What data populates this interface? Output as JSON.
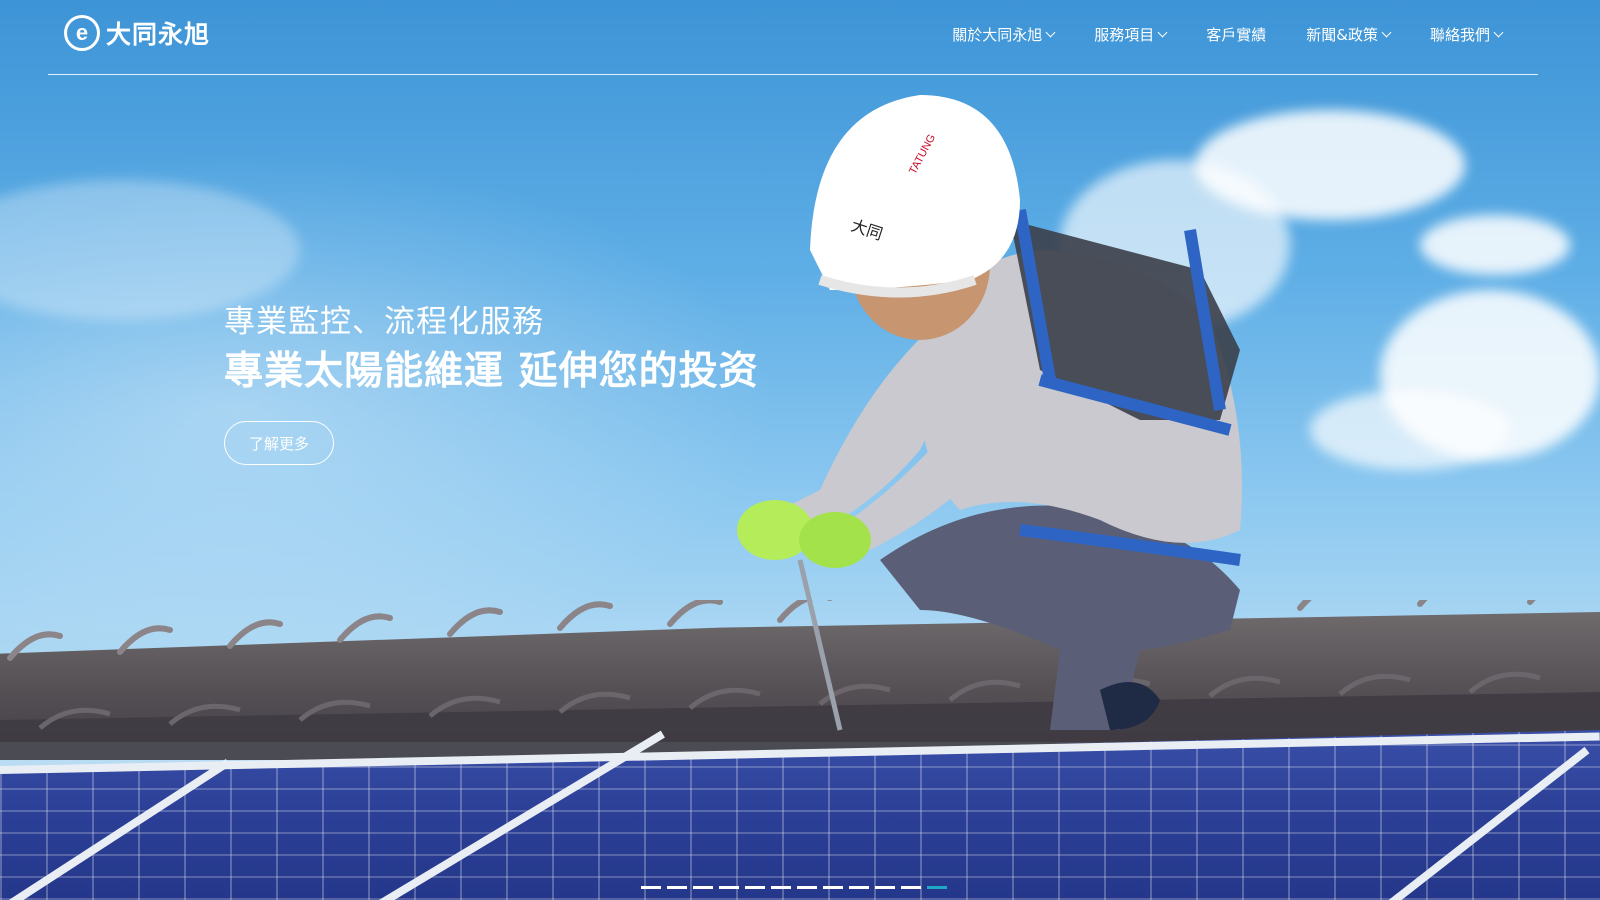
{
  "header": {
    "logo_mark": "e",
    "logo_text": "大同永旭",
    "menu": [
      {
        "label": "關於大同永旭",
        "has_dropdown": true
      },
      {
        "label": "服務項目",
        "has_dropdown": true
      },
      {
        "label": "客戶實績",
        "has_dropdown": false
      },
      {
        "label": "新聞&政策",
        "has_dropdown": true
      },
      {
        "label": "聯絡我們",
        "has_dropdown": true
      }
    ]
  },
  "hero": {
    "subtitle": "專業監控、流程化服務",
    "title": "專業太陽能維運 延伸您的投资",
    "button_label": "了解更多"
  },
  "slider": {
    "total_slides": 12,
    "active_index": 11,
    "active_color": "#1fa8c4",
    "inactive_color": "#ffffff"
  },
  "colors": {
    "sky_top": "#3d94d6",
    "text": "#ffffff"
  }
}
